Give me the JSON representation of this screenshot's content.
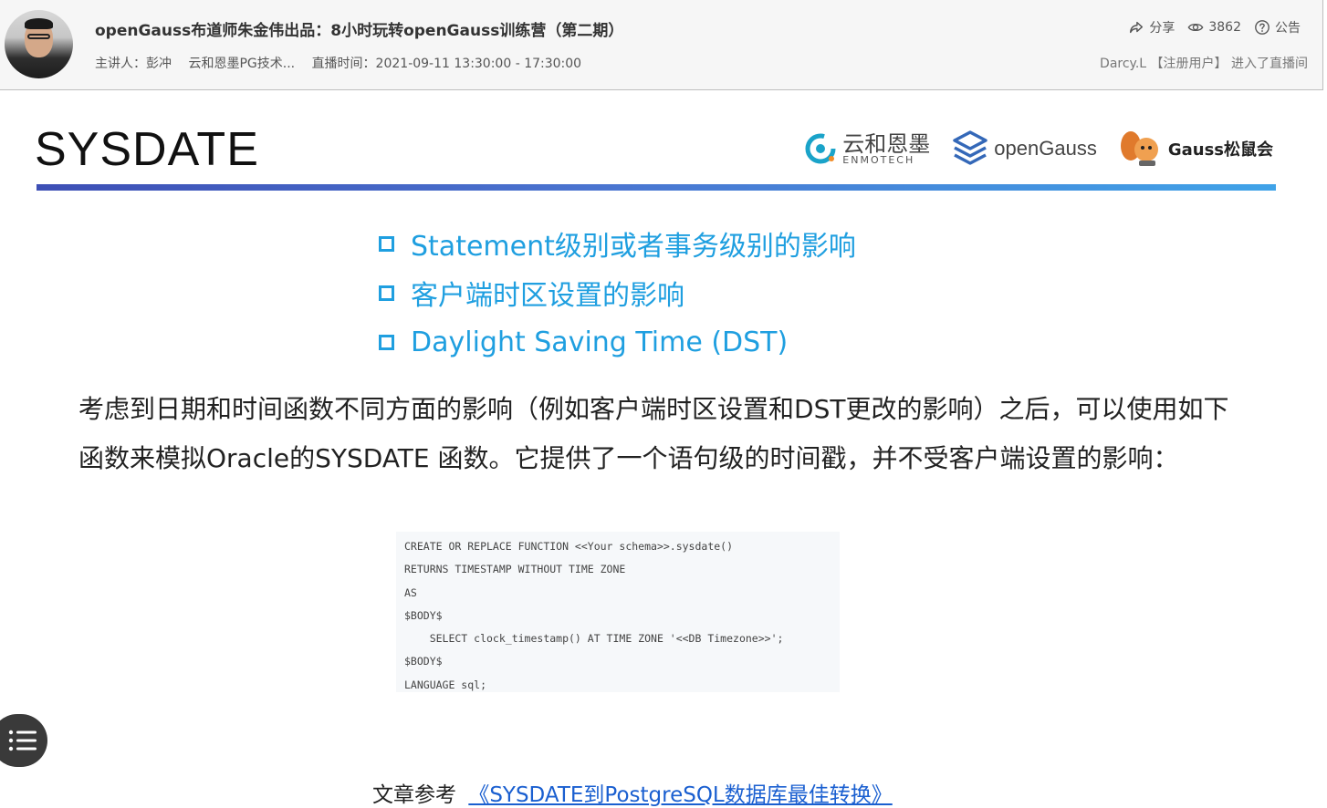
{
  "header": {
    "title": "openGauss布道师朱金伟出品：8小时玩转openGauss训练营（第二期）",
    "presenter": "主讲人：彭冲",
    "org": "云和恩墨PG技术...",
    "live_time": "直播时间：2021-09-11 13:30:00 - 17:30:00",
    "share_label": "分享",
    "view_count": "3862",
    "notice_label": "公告",
    "join_message": "Darcy.L 【注册用户】 进入了直播间"
  },
  "slide": {
    "title": "SYSDATE",
    "logos": {
      "enmo_cn": "云和恩墨",
      "enmo_en": "ENMOTECH",
      "opengauss": "openGauss",
      "gauss_club": "Gauss松鼠会"
    },
    "bullets": [
      "Statement级别或者事务级别的影响",
      "客户端时区设置的影响",
      "Daylight Saving Time (DST)"
    ],
    "paragraph": "考虑到日期和时间函数不同方面的影响（例如客户端时区设置和DST更改的影响）之后，可以使用如下函数来模拟Oracle的SYSDATE 函数。它提供了一个语句级的时间戳，并不受客户端设置的影响：",
    "code_lines": [
      "CREATE OR REPLACE FUNCTION <<Your schema>>.sysdate()",
      "RETURNS TIMESTAMP WITHOUT TIME ZONE",
      "AS",
      "$BODY$",
      "    SELECT clock_timestamp() AT TIME ZONE '<<DB Timezone>>';",
      "$BODY$",
      "LANGUAGE sql;"
    ],
    "reference_label": "文章参考",
    "reference_link": "《SYSDATE到PostgreSQL数据库最佳转换》"
  },
  "colors": {
    "accent_blue": "#1f9fe0",
    "link_blue": "#1a5fd0",
    "divider_start": "#3d4fb5",
    "divider_end": "#40a3e8"
  },
  "icons": [
    "share-icon",
    "eye-icon",
    "help-icon",
    "list-menu-icon"
  ]
}
